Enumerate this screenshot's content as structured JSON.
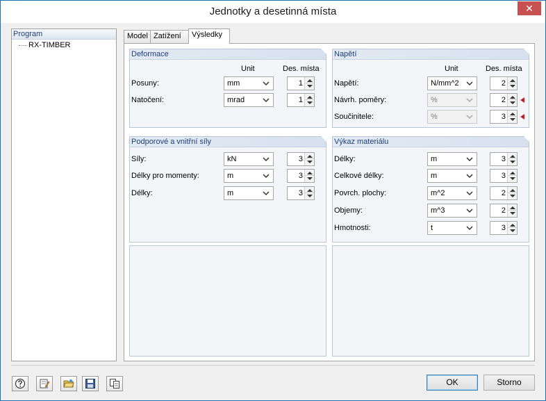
{
  "window": {
    "title": "Jednotky a desetinná místa",
    "close_glyph": "✕"
  },
  "left_panel": {
    "header": "Program",
    "tree_item": "RX-TIMBER"
  },
  "tabs": [
    {
      "label": "Model"
    },
    {
      "label": "Zatížení"
    },
    {
      "label": "Výsledky",
      "active": true
    }
  ],
  "groups": {
    "deformace": {
      "title": "Deformace",
      "unit_header": "Unit",
      "dec_header": "Des. místa",
      "rows": [
        {
          "label": "Posuny:",
          "unit": "mm",
          "decimals": "1"
        },
        {
          "label": "Natočení:",
          "unit": "mrad",
          "decimals": "1"
        }
      ]
    },
    "napeti": {
      "title": "Napětí",
      "unit_header": "Unit",
      "dec_header": "Des. místa",
      "rows": [
        {
          "label": "Napětí:",
          "unit": "N/mm^2",
          "decimals": "2",
          "disabled": false
        },
        {
          "label": "Návrh. poměry:",
          "unit": "%",
          "decimals": "2",
          "disabled": true
        },
        {
          "label": "Součinitele:",
          "unit": "%",
          "decimals": "3",
          "disabled": true
        }
      ]
    },
    "sily": {
      "title": "Podporové a vnitřní síly",
      "rows": [
        {
          "label": "Síly:",
          "unit": "kN",
          "decimals": "3"
        },
        {
          "label": "Délky pro momenty:",
          "unit": "m",
          "decimals": "3"
        },
        {
          "label": "Délky:",
          "unit": "m",
          "decimals": "3"
        }
      ]
    },
    "vykaz": {
      "title": "Výkaz materiálu",
      "rows": [
        {
          "label": "Délky:",
          "unit": "m",
          "decimals": "3"
        },
        {
          "label": "Celkové délky:",
          "unit": "m",
          "decimals": "3"
        },
        {
          "label": "Povrch. plochy:",
          "unit": "m^2",
          "decimals": "2"
        },
        {
          "label": "Objemy:",
          "unit": "m^3",
          "decimals": "2"
        },
        {
          "label": "Hmotnosti:",
          "unit": "t",
          "decimals": "3"
        }
      ]
    }
  },
  "toolbar_icons": [
    "help-icon",
    "edit-icon",
    "open-folder-icon",
    "save-icon",
    "copy-icon"
  ],
  "buttons": {
    "ok": "OK",
    "cancel": "Storno"
  },
  "colors": {
    "accent": "#1f6fb5",
    "group_title": "#1f3e7a",
    "marker": "#c0202a"
  }
}
